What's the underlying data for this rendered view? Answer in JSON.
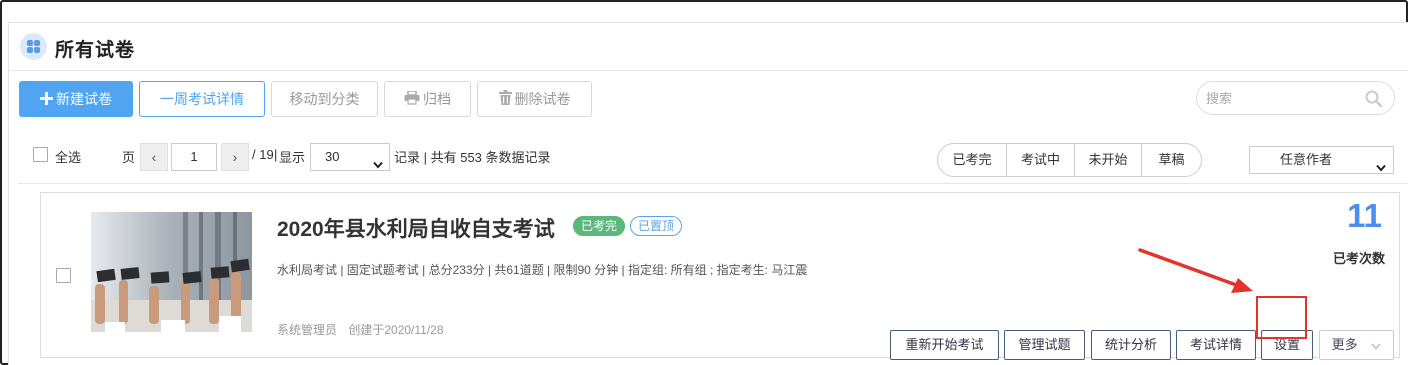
{
  "header": {
    "title": "所有试卷",
    "icon": "apps-grid-icon"
  },
  "toolbar": {
    "new_label": "新建试卷",
    "weekly_label": "一周考试详情",
    "move_label": "移动到分类",
    "archive_label": "归档",
    "delete_label": "删除试卷"
  },
  "search": {
    "placeholder": "搜索",
    "value": ""
  },
  "pager": {
    "select_all": "全选",
    "page_label": "页",
    "prev": "‹",
    "next": "›",
    "current_page": "1",
    "total_pages_text": "/ 19",
    "display_label": "显示",
    "page_size": "30",
    "summary": "记录 | 共有 553 条数据记录"
  },
  "status_filters": [
    "已考完",
    "考试中",
    "未开始",
    "草稿"
  ],
  "author_filter": {
    "selected": "任意作者"
  },
  "exam": {
    "title": "2020年县水利局自收自支考试",
    "status_tag": "已考完",
    "pinned_tag": "已置顶",
    "meta": "水利局考试 | 固定试题考试 | 总分233分 | 共61道题 | 限制90 分钟 | 指定组: 所有组 ; 指定考生: 马江震",
    "creator": "系统管理员",
    "created": "创建于2020/11/28",
    "taken_count": "11",
    "taken_label": "已考次数",
    "actions": {
      "restart": "重新开始考试",
      "manage": "管理试题",
      "stats": "统计分析",
      "detail": "考试详情",
      "settings": "设置",
      "more": "更多"
    }
  },
  "colors": {
    "primary": "#51a4f2",
    "count_blue": "#4a8ff0",
    "done_green": "#5cb87a",
    "annotation_red": "#e5332a"
  }
}
